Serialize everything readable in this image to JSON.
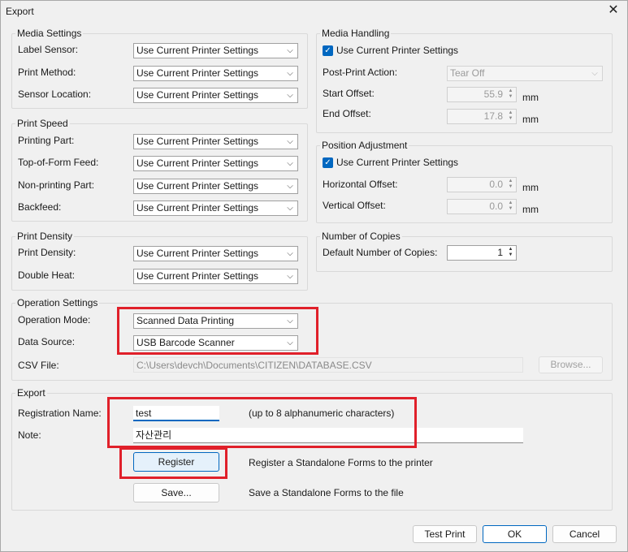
{
  "window": {
    "title": "Export"
  },
  "media_settings": {
    "legend": "Media Settings",
    "rows": [
      {
        "label": "Label Sensor:",
        "value": "Use Current Printer Settings"
      },
      {
        "label": "Print Method:",
        "value": "Use Current Printer Settings"
      },
      {
        "label": "Sensor Location:",
        "value": "Use Current Printer Settings"
      }
    ]
  },
  "print_speed": {
    "legend": "Print Speed",
    "rows": [
      {
        "label": "Printing Part:",
        "value": "Use Current Printer Settings"
      },
      {
        "label": "Top-of-Form Feed:",
        "value": "Use Current Printer Settings"
      },
      {
        "label": "Non-printing Part:",
        "value": "Use Current Printer Settings"
      },
      {
        "label": "Backfeed:",
        "value": "Use Current Printer Settings"
      }
    ]
  },
  "print_density": {
    "legend": "Print Density",
    "rows": [
      {
        "label": "Print Density:",
        "value": "Use Current Printer Settings"
      },
      {
        "label": "Double Heat:",
        "value": "Use Current Printer Settings"
      }
    ]
  },
  "media_handling": {
    "legend": "Media Handling",
    "use_current_label": "Use Current Printer Settings",
    "use_current_checked": true,
    "post_print_label": "Post-Print Action:",
    "post_print_value": "Tear Off",
    "start_offset_label": "Start Offset:",
    "start_offset_value": "55.9",
    "end_offset_label": "End Offset:",
    "end_offset_value": "17.8",
    "unit": "mm"
  },
  "position_adjustment": {
    "legend": "Position Adjustment",
    "use_current_label": "Use Current Printer Settings",
    "use_current_checked": true,
    "horizontal_label": "Horizontal Offset:",
    "horizontal_value": "0.0",
    "vertical_label": "Vertical Offset:",
    "vertical_value": "0.0",
    "unit": "mm"
  },
  "copies": {
    "legend": "Number of Copies",
    "label": "Default Number of Copies:",
    "value": "1"
  },
  "operation_settings": {
    "legend": "Operation Settings",
    "mode_label": "Operation Mode:",
    "mode_value": "Scanned Data Printing",
    "source_label": "Data Source:",
    "source_value": "USB Barcode Scanner",
    "csv_label": "CSV File:",
    "csv_value": "C:\\Users\\devch\\Documents\\CITIZEN\\DATABASE.CSV",
    "browse_label": "Browse..."
  },
  "export": {
    "legend": "Export",
    "reg_name_label": "Registration Name:",
    "reg_name_value": "test",
    "reg_name_hint": "(up to 8 alphanumeric characters)",
    "note_label": "Note:",
    "note_value": "자산관리",
    "register_label": "Register",
    "register_desc": "Register a Standalone Forms to the printer",
    "save_label": "Save...",
    "save_desc": "Save a Standalone Forms to the file"
  },
  "footer": {
    "test_print_label": "Test Print",
    "ok_label": "OK",
    "cancel_label": "Cancel"
  },
  "colors": {
    "highlight": "#e0202a",
    "accent": "#0067c0"
  }
}
